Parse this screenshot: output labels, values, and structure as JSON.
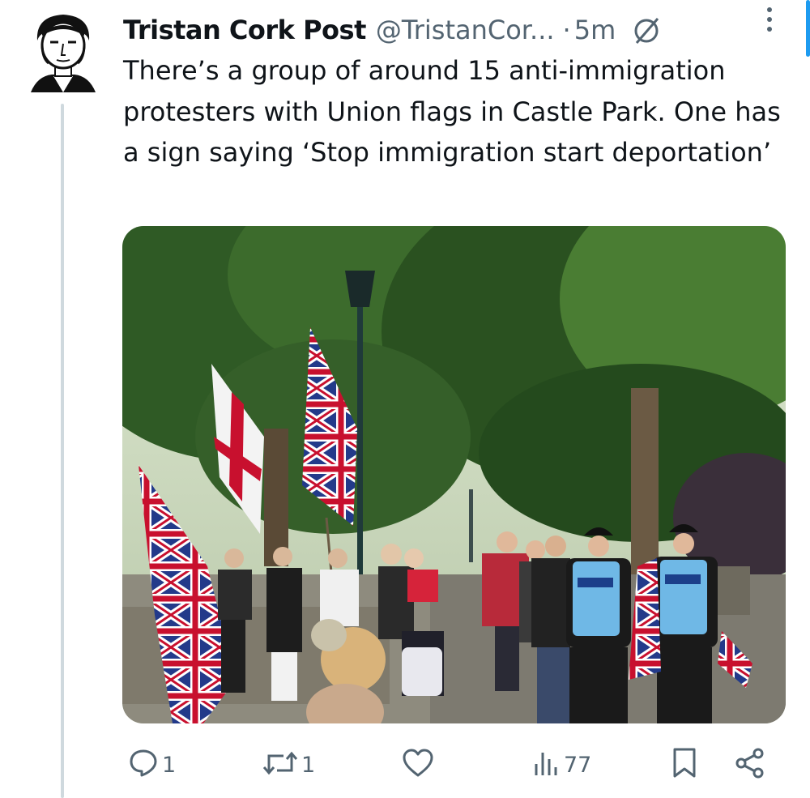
{
  "post": {
    "author_name": "Tristan Cork Post",
    "handle": "@TristanCor...",
    "separator": "·",
    "time": "5m",
    "text": "There’s a group of around 15 anti-immigration protesters with Union flags in Castle Park. One has a sign saying ‘Stop immigration start deportation’"
  },
  "icons": {
    "avatar": "sketched-portrait-avatar",
    "header_badge": "clock-slash-icon",
    "more": "more-vertical-icon",
    "reply": "reply-icon",
    "repost": "repost-icon",
    "like": "heart-icon",
    "views": "views-bar-icon",
    "bookmark": "bookmark-icon",
    "share": "share-icon"
  },
  "actions": {
    "replies": "1",
    "reposts": "1",
    "likes": "",
    "views": "77"
  },
  "colors": {
    "text": "#0f1419",
    "secondary": "#536471",
    "thread_line": "#cfd9de",
    "accent": "#1d9bf0"
  }
}
